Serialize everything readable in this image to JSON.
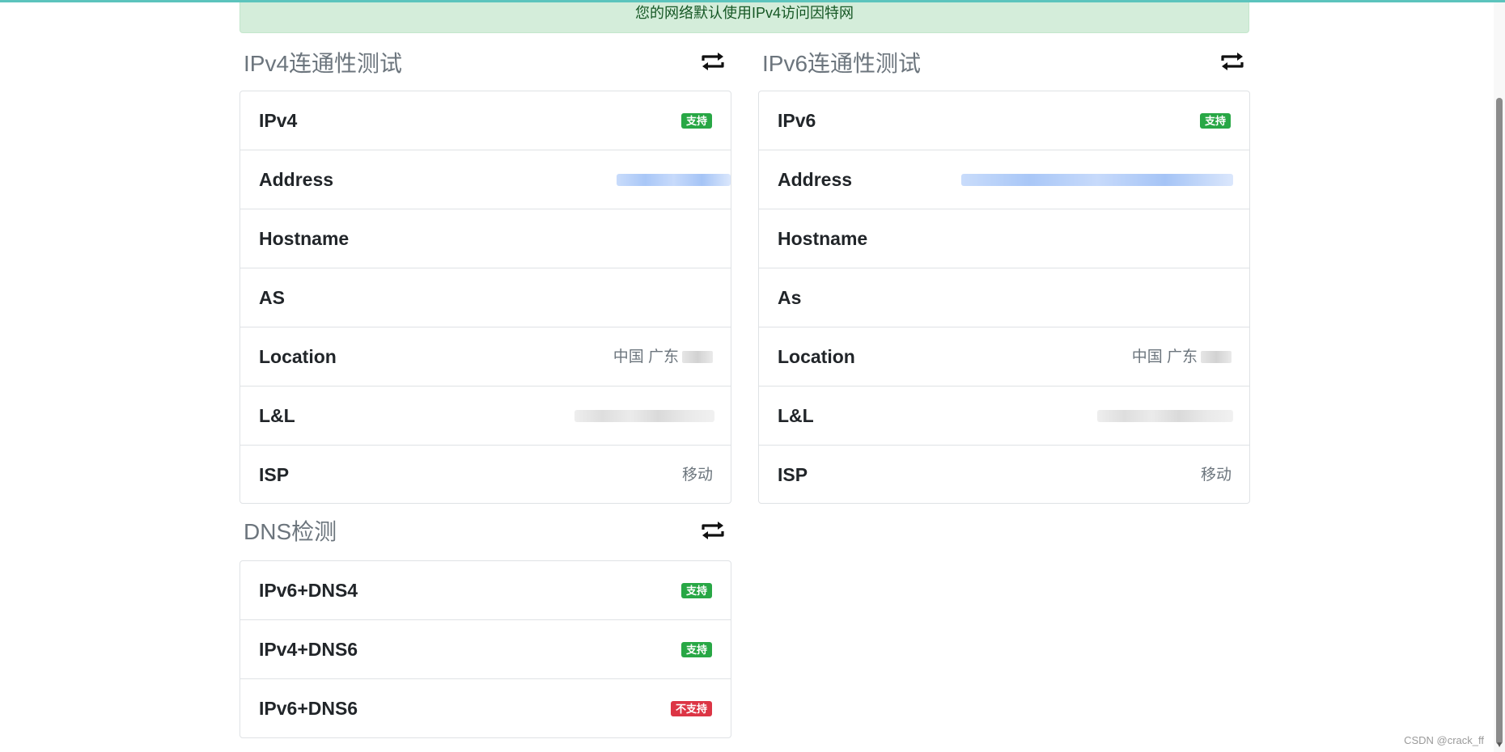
{
  "alert": {
    "text": "您的网络默认使用IPv4访问因特网"
  },
  "ipv4_panel": {
    "title": "IPv4连通性测试",
    "rows": [
      {
        "key": "IPv4",
        "badge": "支持"
      },
      {
        "key": "Address",
        "value": ""
      },
      {
        "key": "Hostname",
        "value": ""
      },
      {
        "key": "AS",
        "value": ""
      },
      {
        "key": "Location",
        "value": "中国 广东"
      },
      {
        "key": "L&L",
        "value": ""
      },
      {
        "key": "ISP",
        "value": "移动"
      }
    ]
  },
  "ipv6_panel": {
    "title": "IPv6连通性测试",
    "rows": [
      {
        "key": "IPv6",
        "badge": "支持"
      },
      {
        "key": "Address",
        "value": ""
      },
      {
        "key": "Hostname",
        "value": ""
      },
      {
        "key": "As",
        "value": ""
      },
      {
        "key": "Location",
        "value": "中国 广东"
      },
      {
        "key": "L&L",
        "value": ""
      },
      {
        "key": "ISP",
        "value": "移动"
      }
    ]
  },
  "dns_panel": {
    "title": "DNS检测",
    "rows": [
      {
        "key": "IPv6+DNS4",
        "badge": "支持",
        "status": "supported"
      },
      {
        "key": "IPv4+DNS6",
        "badge": "支持",
        "status": "supported"
      },
      {
        "key": "IPv6+DNS6",
        "badge": "不支持",
        "status": "unsupported"
      }
    ]
  },
  "watermark": "CSDN @crack_ff",
  "colors": {
    "success": "#28a745",
    "danger": "#dc3545",
    "alert_bg": "#d4edda",
    "alert_text": "#155724",
    "accent": "#5cc4bd"
  },
  "icons": {
    "refresh": "refresh-icon"
  }
}
